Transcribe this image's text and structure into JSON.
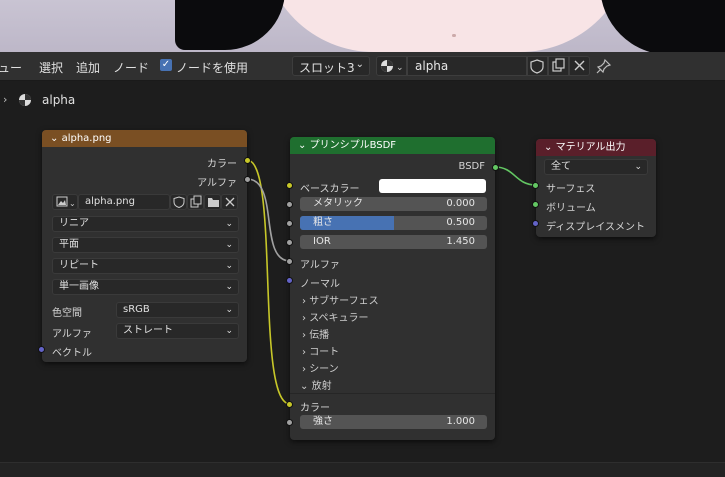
{
  "viewport": {
    "description_colors": {
      "skin": "#f8e4e6",
      "hair": "#0b0b0d",
      "bg": "#c9c4d3"
    }
  },
  "header": {
    "menus": [
      "ビュー",
      "選択",
      "追加",
      "ノード"
    ],
    "use_nodes_label": "ノードを使用",
    "slot_label": "スロット3",
    "material_name": "alpha",
    "menu_first_visible": "ュー"
  },
  "breadcrumb": {
    "label": "alpha"
  },
  "image_node": {
    "title": "alpha.png",
    "outputs": [
      "カラー",
      "アルファ"
    ],
    "image_name": "alpha.png",
    "interpolation": "リニア",
    "projection": "平面",
    "extension": "リピート",
    "source": "単一画像",
    "colorspace_label": "色空間",
    "colorspace_value": "sRGB",
    "alpha_label": "アルファ",
    "alpha_value": "ストレート",
    "vector_label": "ベクトル",
    "header_color": "#7a4f23"
  },
  "bsdf_node": {
    "title": "プリンシプルBSDF",
    "output": "BSDF",
    "base_color_label": "ベースカラー",
    "metallic_label": "メタリック",
    "metallic_value": "0.000",
    "roughness_label": "粗さ",
    "roughness_value": "0.500",
    "roughness_fraction": 0.5,
    "ior_label": "IOR",
    "ior_value": "1.450",
    "alpha_label": "アルファ",
    "normal_label": "ノーマル",
    "panels": [
      "サブサーフェス",
      "スペキュラー",
      "伝播",
      "コート",
      "シーン"
    ],
    "emission_label": "放射",
    "emission_color_label": "カラー",
    "strength_label": "強さ",
    "strength_value": "1.000",
    "header_color": "#1f6f2f"
  },
  "output_node": {
    "title": "マテリアル出力",
    "target": "全て",
    "surface_label": "サーフェス",
    "volume_label": "ボリューム",
    "displacement_label": "ディスプレイスメント",
    "header_color": "#5a1f2a"
  }
}
